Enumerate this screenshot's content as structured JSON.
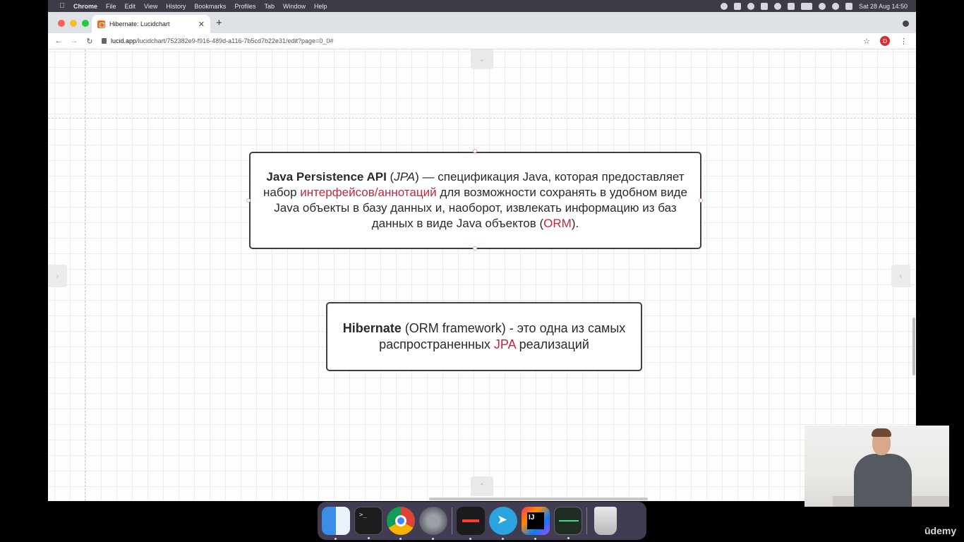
{
  "menubar": {
    "app": "Chrome",
    "items": [
      "File",
      "Edit",
      "View",
      "History",
      "Bookmarks",
      "Profiles",
      "Tab",
      "Window",
      "Help"
    ],
    "clock": "Sat 28 Aug  14:50"
  },
  "browser": {
    "tab_title": "Hibernate: Lucidchart",
    "url_host": "lucid.app",
    "url_path": "/lucidchart/752382e9-f916-489d-a116-7b5cd7b22e31/edit?page=0_0#",
    "profile_initial": "D"
  },
  "diagram": {
    "box1": {
      "bold": "Java Persistence API",
      "p1": " (",
      "italic": "JPA",
      "p2": ") — спецификация Java, которая предоставляет набор ",
      "red1": "интерфейсов/аннотаций",
      "p3": " для возможности сохранять в удобном виде Java объекты в базу данных и, наоборот, извлекать информацию из баз данных в виде Java объектов (",
      "red2": "ORM",
      "p4": ")."
    },
    "box2": {
      "bold": "Hibernate",
      "p1": " (ORM framework) - это одна из самых распространенных ",
      "red": "JPA",
      "p2": " реализаций"
    }
  },
  "dock": {
    "apps": [
      "finder-icon",
      "terminal-icon",
      "chrome-icon",
      "system-preferences-icon",
      "voice-memos-icon",
      "telegram-icon",
      "intellij-idea-icon",
      "activity-monitor-icon",
      "trash-icon"
    ]
  },
  "watermark": "ūdemy",
  "colors": {
    "accent_red": "#c0283d",
    "box_border": "#3f3f3f",
    "menubar_bg": "#3e3a46"
  }
}
